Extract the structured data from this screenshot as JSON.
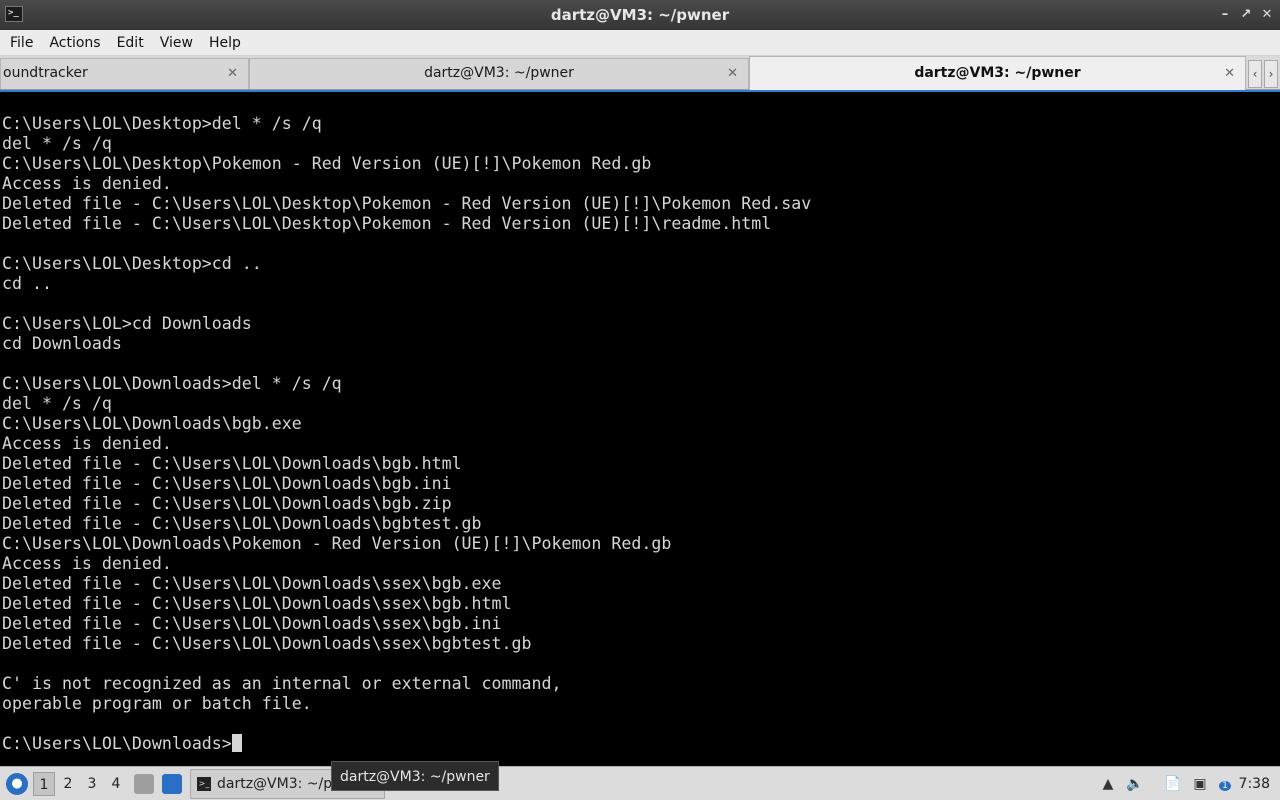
{
  "window": {
    "title": "dartz@VM3: ~/pwner",
    "app_icon": "terminal-icon",
    "controls": [
      "minimize-icon",
      "maximize-icon",
      "close-icon"
    ]
  },
  "menu": [
    "File",
    "Actions",
    "Edit",
    "View",
    "Help"
  ],
  "tabs": [
    {
      "label": "oundtracker",
      "active": false
    },
    {
      "label": "dartz@VM3: ~/pwner",
      "active": false
    },
    {
      "label": "dartz@VM3: ~/pwner",
      "active": true
    }
  ],
  "terminal": {
    "lines": [
      "C:\\Users\\LOL\\Desktop>del * /s /q",
      "del * /s /q",
      "C:\\Users\\LOL\\Desktop\\Pokemon - Red Version (UE)[!]\\Pokemon Red.gb",
      "Access is denied.",
      "Deleted file - C:\\Users\\LOL\\Desktop\\Pokemon - Red Version (UE)[!]\\Pokemon Red.sav",
      "Deleted file - C:\\Users\\LOL\\Desktop\\Pokemon - Red Version (UE)[!]\\readme.html",
      "",
      "C:\\Users\\LOL\\Desktop>cd ..",
      "cd ..",
      "",
      "C:\\Users\\LOL>cd Downloads",
      "cd Downloads",
      "",
      "C:\\Users\\LOL\\Downloads>del * /s /q",
      "del * /s /q",
      "C:\\Users\\LOL\\Downloads\\bgb.exe",
      "Access is denied.",
      "Deleted file - C:\\Users\\LOL\\Downloads\\bgb.html",
      "Deleted file - C:\\Users\\LOL\\Downloads\\bgb.ini",
      "Deleted file - C:\\Users\\LOL\\Downloads\\bgb.zip",
      "Deleted file - C:\\Users\\LOL\\Downloads\\bgbtest.gb",
      "C:\\Users\\LOL\\Downloads\\Pokemon - Red Version (UE)[!]\\Pokemon Red.gb",
      "Access is denied.",
      "Deleted file - C:\\Users\\LOL\\Downloads\\ssex\\bgb.exe",
      "Deleted file - C:\\Users\\LOL\\Downloads\\ssex\\bgb.html",
      "Deleted file - C:\\Users\\LOL\\Downloads\\ssex\\bgb.ini",
      "Deleted file - C:\\Users\\LOL\\Downloads\\ssex\\bgbtest.gb",
      "",
      "C' is not recognized as an internal or external command,",
      "operable program or batch file.",
      ""
    ],
    "prompt": "C:\\Users\\LOL\\Downloads>"
  },
  "taskbar": {
    "workspaces": [
      "1",
      "2",
      "3",
      "4"
    ],
    "active_workspace": "1",
    "task_label": "dartz@VM3: ~/pwner",
    "tooltip": "dartz@VM3: ~/pwner",
    "tray_icons": [
      "window-manager-icon",
      "volume-icon",
      "file-manager-icon",
      "network-icon",
      "notification-icon"
    ],
    "notification_count": "1",
    "clock": "7:38"
  },
  "colors": {
    "terminal_bg": "#000000",
    "terminal_fg": "#d6d6d6",
    "accent": "#2f7bd8"
  }
}
